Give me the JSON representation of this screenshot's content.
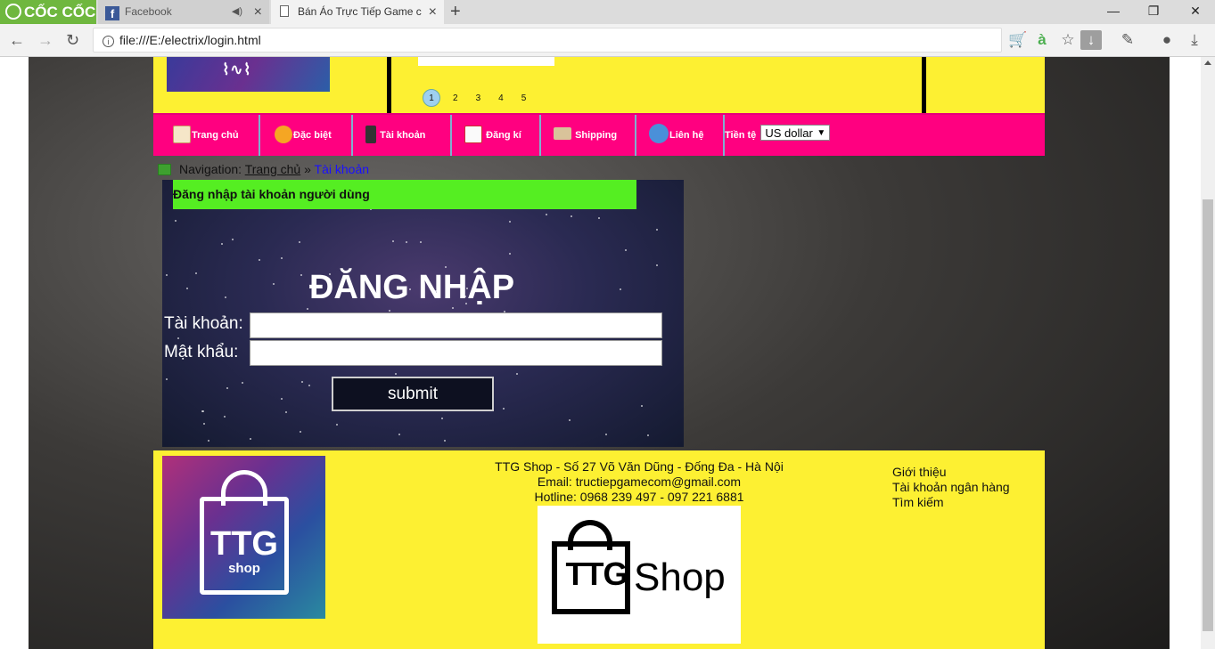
{
  "browser": {
    "brand": "CỐC CỐC",
    "tabs": [
      {
        "title": "Facebook"
      },
      {
        "title": "Bán Áo Trực Tiếp Game c"
      }
    ],
    "url": "file:///E:/electrix/login.html",
    "icons": {
      "back": "back-arrow-icon",
      "forward": "forward-arrow-icon",
      "reload": "reload-icon",
      "cart": "shopping-cart-icon",
      "dictionary": "dictionary-icon",
      "star": "star-icon",
      "download": "download-icon",
      "extension": "extension-icon",
      "account": "account-icon",
      "downloads": "downloads-icon"
    }
  },
  "header": {
    "pager": [
      "1",
      "2",
      "3",
      "4",
      "5"
    ]
  },
  "menu": {
    "items": [
      {
        "label": "Trang chủ",
        "icon": "home-icon"
      },
      {
        "label": "Đặc biệt",
        "icon": "thumbs-up-icon"
      },
      {
        "label": "Tài khoản",
        "icon": "user-icon"
      },
      {
        "label": "Đăng kí",
        "icon": "register-icon"
      },
      {
        "label": "Shipping",
        "icon": "shipping-icon"
      },
      {
        "label": "Liên hệ",
        "icon": "phone-icon"
      }
    ],
    "currency_label": "Tiền tệ",
    "currency_value": "US dollar"
  },
  "breadcrumb": {
    "prefix": "Navigation:",
    "home": "Trang chủ",
    "separator": "»",
    "current": "Tài khoản"
  },
  "login": {
    "panel_title": "Đăng nhập tài khoản người dùng",
    "heading": "ĐĂNG NHẬP",
    "username_label": "Tài khoản:",
    "username_value": "",
    "password_label": "Mật khẩu:",
    "password_value": "",
    "submit_label": "submit"
  },
  "footer": {
    "logo_ttg": "TTG",
    "logo_shop": "shop",
    "address": "TTG Shop - Số 27 Võ Văn Dũng - Đống Đa - Hà Nội",
    "email": "Email: tructiepgamecom@gmail.com",
    "hotline": "Hotline: 0968 239 497 - 097 221 6881",
    "brand_ttg": "TTG",
    "brand_shop": "Shop",
    "links": [
      "Giới thiệu",
      "Tài khoản ngân hàng",
      "Tìm kiếm"
    ]
  },
  "colors": {
    "header_yellow": "#fdf032",
    "menu_pink": "#ff0080",
    "title_green": "#55ee22",
    "breadcrumb_current": "#1a10ff"
  }
}
